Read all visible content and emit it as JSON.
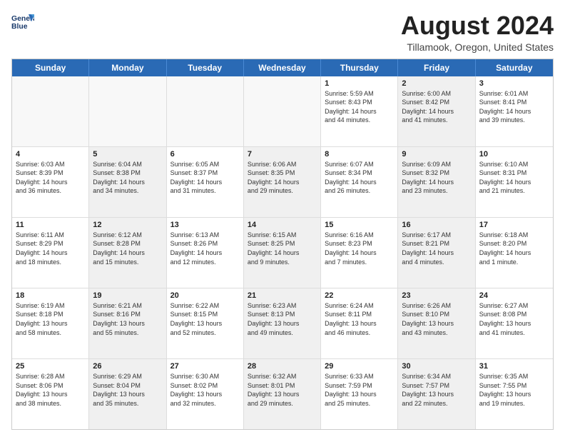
{
  "logo": {
    "line1": "General",
    "line2": "Blue"
  },
  "title": "August 2024",
  "subtitle": "Tillamook, Oregon, United States",
  "days_of_week": [
    "Sunday",
    "Monday",
    "Tuesday",
    "Wednesday",
    "Thursday",
    "Friday",
    "Saturday"
  ],
  "weeks": [
    [
      {
        "day": "",
        "info": "",
        "shaded": false,
        "empty": true
      },
      {
        "day": "",
        "info": "",
        "shaded": false,
        "empty": true
      },
      {
        "day": "",
        "info": "",
        "shaded": false,
        "empty": true
      },
      {
        "day": "",
        "info": "",
        "shaded": false,
        "empty": true
      },
      {
        "day": "1",
        "info": "Sunrise: 5:59 AM\nSunset: 8:43 PM\nDaylight: 14 hours\nand 44 minutes.",
        "shaded": false,
        "empty": false
      },
      {
        "day": "2",
        "info": "Sunrise: 6:00 AM\nSunset: 8:42 PM\nDaylight: 14 hours\nand 41 minutes.",
        "shaded": true,
        "empty": false
      },
      {
        "day": "3",
        "info": "Sunrise: 6:01 AM\nSunset: 8:41 PM\nDaylight: 14 hours\nand 39 minutes.",
        "shaded": false,
        "empty": false
      }
    ],
    [
      {
        "day": "4",
        "info": "Sunrise: 6:03 AM\nSunset: 8:39 PM\nDaylight: 14 hours\nand 36 minutes.",
        "shaded": false,
        "empty": false
      },
      {
        "day": "5",
        "info": "Sunrise: 6:04 AM\nSunset: 8:38 PM\nDaylight: 14 hours\nand 34 minutes.",
        "shaded": true,
        "empty": false
      },
      {
        "day": "6",
        "info": "Sunrise: 6:05 AM\nSunset: 8:37 PM\nDaylight: 14 hours\nand 31 minutes.",
        "shaded": false,
        "empty": false
      },
      {
        "day": "7",
        "info": "Sunrise: 6:06 AM\nSunset: 8:35 PM\nDaylight: 14 hours\nand 29 minutes.",
        "shaded": true,
        "empty": false
      },
      {
        "day": "8",
        "info": "Sunrise: 6:07 AM\nSunset: 8:34 PM\nDaylight: 14 hours\nand 26 minutes.",
        "shaded": false,
        "empty": false
      },
      {
        "day": "9",
        "info": "Sunrise: 6:09 AM\nSunset: 8:32 PM\nDaylight: 14 hours\nand 23 minutes.",
        "shaded": true,
        "empty": false
      },
      {
        "day": "10",
        "info": "Sunrise: 6:10 AM\nSunset: 8:31 PM\nDaylight: 14 hours\nand 21 minutes.",
        "shaded": false,
        "empty": false
      }
    ],
    [
      {
        "day": "11",
        "info": "Sunrise: 6:11 AM\nSunset: 8:29 PM\nDaylight: 14 hours\nand 18 minutes.",
        "shaded": false,
        "empty": false
      },
      {
        "day": "12",
        "info": "Sunrise: 6:12 AM\nSunset: 8:28 PM\nDaylight: 14 hours\nand 15 minutes.",
        "shaded": true,
        "empty": false
      },
      {
        "day": "13",
        "info": "Sunrise: 6:13 AM\nSunset: 8:26 PM\nDaylight: 14 hours\nand 12 minutes.",
        "shaded": false,
        "empty": false
      },
      {
        "day": "14",
        "info": "Sunrise: 6:15 AM\nSunset: 8:25 PM\nDaylight: 14 hours\nand 9 minutes.",
        "shaded": true,
        "empty": false
      },
      {
        "day": "15",
        "info": "Sunrise: 6:16 AM\nSunset: 8:23 PM\nDaylight: 14 hours\nand 7 minutes.",
        "shaded": false,
        "empty": false
      },
      {
        "day": "16",
        "info": "Sunrise: 6:17 AM\nSunset: 8:21 PM\nDaylight: 14 hours\nand 4 minutes.",
        "shaded": true,
        "empty": false
      },
      {
        "day": "17",
        "info": "Sunrise: 6:18 AM\nSunset: 8:20 PM\nDaylight: 14 hours\nand 1 minute.",
        "shaded": false,
        "empty": false
      }
    ],
    [
      {
        "day": "18",
        "info": "Sunrise: 6:19 AM\nSunset: 8:18 PM\nDaylight: 13 hours\nand 58 minutes.",
        "shaded": false,
        "empty": false
      },
      {
        "day": "19",
        "info": "Sunrise: 6:21 AM\nSunset: 8:16 PM\nDaylight: 13 hours\nand 55 minutes.",
        "shaded": true,
        "empty": false
      },
      {
        "day": "20",
        "info": "Sunrise: 6:22 AM\nSunset: 8:15 PM\nDaylight: 13 hours\nand 52 minutes.",
        "shaded": false,
        "empty": false
      },
      {
        "day": "21",
        "info": "Sunrise: 6:23 AM\nSunset: 8:13 PM\nDaylight: 13 hours\nand 49 minutes.",
        "shaded": true,
        "empty": false
      },
      {
        "day": "22",
        "info": "Sunrise: 6:24 AM\nSunset: 8:11 PM\nDaylight: 13 hours\nand 46 minutes.",
        "shaded": false,
        "empty": false
      },
      {
        "day": "23",
        "info": "Sunrise: 6:26 AM\nSunset: 8:10 PM\nDaylight: 13 hours\nand 43 minutes.",
        "shaded": true,
        "empty": false
      },
      {
        "day": "24",
        "info": "Sunrise: 6:27 AM\nSunset: 8:08 PM\nDaylight: 13 hours\nand 41 minutes.",
        "shaded": false,
        "empty": false
      }
    ],
    [
      {
        "day": "25",
        "info": "Sunrise: 6:28 AM\nSunset: 8:06 PM\nDaylight: 13 hours\nand 38 minutes.",
        "shaded": false,
        "empty": false
      },
      {
        "day": "26",
        "info": "Sunrise: 6:29 AM\nSunset: 8:04 PM\nDaylight: 13 hours\nand 35 minutes.",
        "shaded": true,
        "empty": false
      },
      {
        "day": "27",
        "info": "Sunrise: 6:30 AM\nSunset: 8:02 PM\nDaylight: 13 hours\nand 32 minutes.",
        "shaded": false,
        "empty": false
      },
      {
        "day": "28",
        "info": "Sunrise: 6:32 AM\nSunset: 8:01 PM\nDaylight: 13 hours\nand 29 minutes.",
        "shaded": true,
        "empty": false
      },
      {
        "day": "29",
        "info": "Sunrise: 6:33 AM\nSunset: 7:59 PM\nDaylight: 13 hours\nand 25 minutes.",
        "shaded": false,
        "empty": false
      },
      {
        "day": "30",
        "info": "Sunrise: 6:34 AM\nSunset: 7:57 PM\nDaylight: 13 hours\nand 22 minutes.",
        "shaded": true,
        "empty": false
      },
      {
        "day": "31",
        "info": "Sunrise: 6:35 AM\nSunset: 7:55 PM\nDaylight: 13 hours\nand 19 minutes.",
        "shaded": false,
        "empty": false
      }
    ]
  ]
}
